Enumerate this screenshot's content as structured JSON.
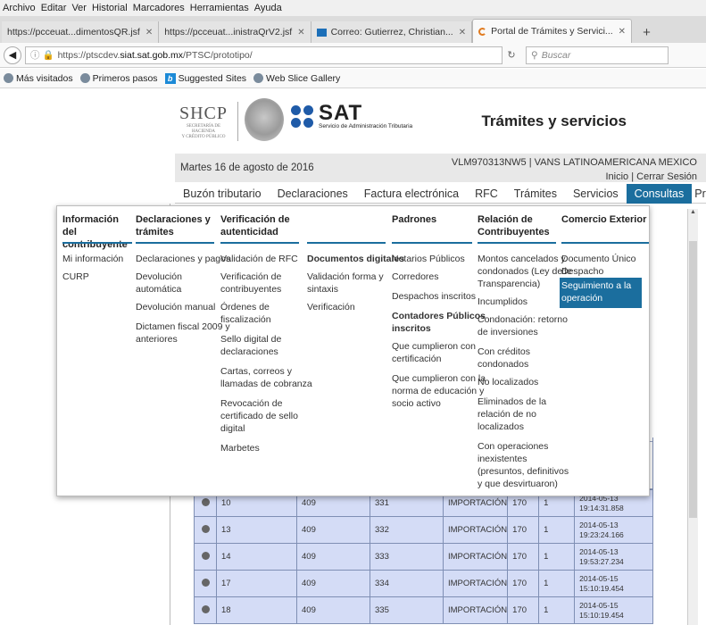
{
  "browser": {
    "menu": [
      "Archivo",
      "Editar",
      "Ver",
      "Historial",
      "Marcadores",
      "Herramientas",
      "Ayuda"
    ],
    "tabs": [
      {
        "label": "https://pcceuat...dimentosQR.jsf"
      },
      {
        "label": "https://pcceuat...inistraQrV2.jsf"
      },
      {
        "label": "Correo: Gutierrez, Christian..."
      },
      {
        "label": "Portal de Trámites y Servici..."
      }
    ],
    "new_tab": "+",
    "url_prefix": "https://ptscdev.",
    "url_domain": "siat.sat.gob.mx",
    "url_path": "/PTSC/prototipo/",
    "search_placeholder": "Buscar",
    "bookmarks": [
      "Más visitados",
      "Primeros pasos",
      "Suggested Sites",
      "Web Slice Gallery"
    ]
  },
  "header": {
    "shcp": "SHCP",
    "shcp_sub1": "SECRETARÍA DE HACIENDA",
    "shcp_sub2": "Y CRÉDITO PÚBLICO",
    "sat": "SAT",
    "sat_sub": "Servicio de Administración Tributaria",
    "title": "Trámites y servicios"
  },
  "datebar": {
    "date": "Martes 16 de agosto de 2016",
    "user": "VLM970313NW5 | VANS LATINOAMERICANA MEXICO",
    "links": "Inicio | Cerrar Sesión"
  },
  "nav": [
    "Buzón tributario",
    "Declaraciones",
    "Factura electrónica",
    "RFC",
    "Trámites",
    "Servicios",
    "Consultas",
    "Pruebas"
  ],
  "mega": {
    "col1": {
      "head": [
        "Información del",
        "contribuyente"
      ],
      "items": [
        "Mi información",
        "CURP"
      ]
    },
    "col2": {
      "head": [
        "Declaraciones y",
        "trámites"
      ],
      "items": [
        "Declaraciones y pagos",
        "Devolución",
        "automática",
        "Devolución manual",
        "Dictamen fiscal 2009 y",
        "anteriores"
      ]
    },
    "col3": {
      "head": [
        "Verificación de",
        "autenticidad"
      ],
      "items": [
        "Validación de RFC",
        "Verificación de",
        "contribuyentes",
        "Órdenes de",
        "fiscalización",
        "Sello digital de",
        "declaraciones",
        "Cartas, correos y",
        "llamadas de cobranza",
        "Revocación de",
        "certificado de sello",
        "digital",
        "Marbetes"
      ]
    },
    "col4": {
      "items": [
        "Documentos digitales",
        "Validación forma y",
        "sintaxis",
        "Verificación"
      ]
    },
    "col5": {
      "head": [
        "Padrones"
      ],
      "items": [
        "Notarios Públicos",
        "Corredores",
        "Despachos inscritos",
        "Contadores Públicos",
        "inscritos",
        "Que cumplieron con",
        "certificación",
        "Que cumplieron con la",
        "norma de educación y",
        "socio activo"
      ]
    },
    "col6": {
      "head": [
        "Relación de",
        "Contribuyentes"
      ],
      "items": [
        "Montos cancelados y",
        "condonados (Ley de",
        "Transparencia)",
        "Incumplidos",
        "Condonación: retorno",
        "de inversiones",
        "Con créditos",
        "condonados",
        "No localizados",
        "Eliminados de la",
        "relación de no",
        "localizados",
        "Con operaciones",
        "inexistentes",
        "(presuntos, definitivos",
        "y que desvirtuaron)"
      ]
    },
    "col7": {
      "head": [
        "Comercio Exterior"
      ],
      "items": [
        "Documento Único de",
        "Despacho",
        "Seguimiento a la",
        "operación"
      ]
    }
  },
  "table_rows": [
    {
      "id": "10",
      "c2": "409",
      "c3": "331",
      "tipo": "IMPORTACIÓN",
      "c5": "170",
      "c6": "1",
      "date": "2014-05-13",
      "time": "19:14:31.858"
    },
    {
      "id": "13",
      "c2": "409",
      "c3": "332",
      "tipo": "IMPORTACIÓN",
      "c5": "170",
      "c6": "1",
      "date": "2014-05-13",
      "time": "19:23:24.166"
    },
    {
      "id": "14",
      "c2": "409",
      "c3": "333",
      "tipo": "IMPORTACIÓN",
      "c5": "170",
      "c6": "1",
      "date": "2014-05-13",
      "time": "19:53:27.234"
    },
    {
      "id": "17",
      "c2": "409",
      "c3": "334",
      "tipo": "IMPORTACIÓN",
      "c5": "170",
      "c6": "1",
      "date": "2014-05-15",
      "time": "15:10:19.454"
    },
    {
      "id": "18",
      "c2": "409",
      "c3": "335",
      "tipo": "IMPORTACIÓN",
      "c5": "170",
      "c6": "1",
      "date": "2014-05-15",
      "time": "15:10:19.454"
    }
  ]
}
